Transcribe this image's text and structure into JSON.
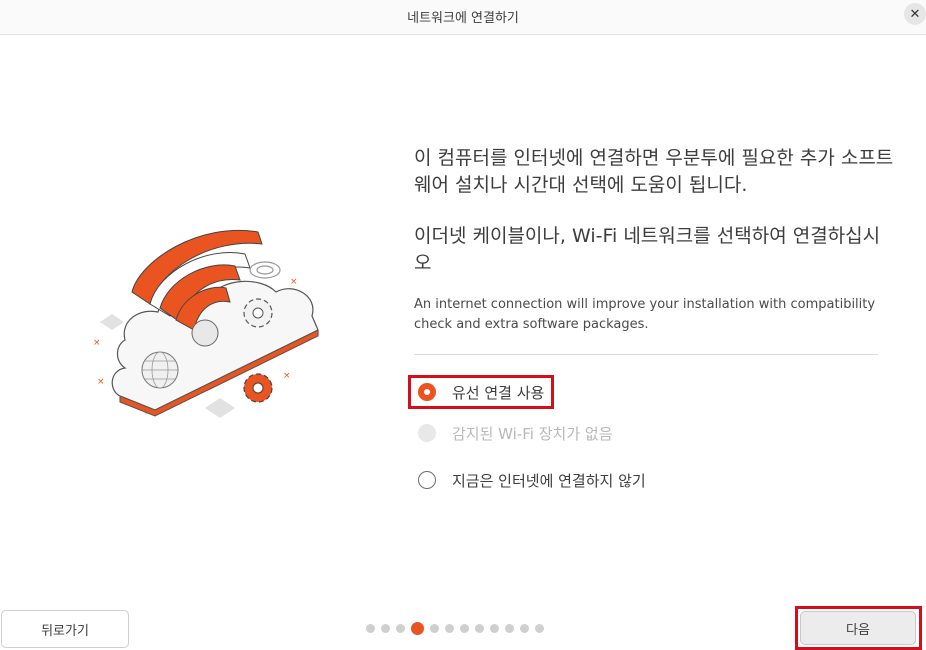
{
  "window": {
    "title": "네트워크에 연결하기",
    "close_icon": "✕"
  },
  "content": {
    "description_ko_1": "이 컴퓨터를 인터넷에 연결하면 우분투에 필요한 추가 소프트웨어 설치나 시간대 선택에 도움이 됩니다.",
    "description_ko_2": "이더넷 케이블이나, Wi-Fi 네트워크를 선택하여 연결하십시오",
    "description_en": "An internet connection will improve your installation with compatibility check and extra software packages."
  },
  "options": [
    {
      "label": "유선 연결 사용",
      "state": "selected"
    },
    {
      "label": "감지된 Wi-Fi 장치가 없음",
      "state": "disabled"
    },
    {
      "label": "지금은 인터넷에 연결하지 않기",
      "state": "unselected"
    }
  ],
  "footer": {
    "back_label": "뒤로가기",
    "next_label": "다음",
    "page_indicator": {
      "total": 12,
      "current": 4
    }
  },
  "colors": {
    "accent": "#e95420",
    "highlight_box": "#d40f1c"
  }
}
